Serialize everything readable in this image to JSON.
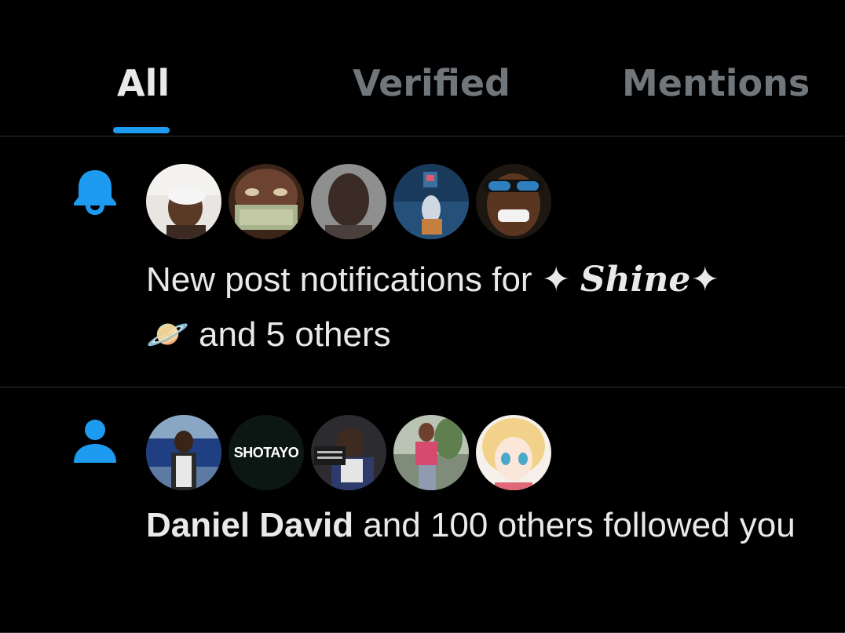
{
  "tabs": [
    {
      "label": "All",
      "active": true
    },
    {
      "label": "Verified",
      "active": false
    },
    {
      "label": "Mentions",
      "active": false
    }
  ],
  "colors": {
    "accent": "#1d9bf0",
    "background": "#000000",
    "text_primary": "#e7e9ea",
    "text_secondary": "#71767b",
    "divider": "#2f3336"
  },
  "notifications": [
    {
      "type_icon": "bell-icon",
      "avatar_count": 5,
      "text": {
        "prefix": "New post notifications for ",
        "star_left": "✦ ",
        "name": "Shine",
        "star_right": "✦",
        "emoji": "🪐",
        "suffix": " and 5 others"
      }
    },
    {
      "type_icon": "person-icon",
      "avatar_count": 5,
      "avatar_label": "SHOTAYO",
      "text": {
        "name": "Daniel David",
        "suffix": " and 100 others followed you"
      }
    }
  ]
}
